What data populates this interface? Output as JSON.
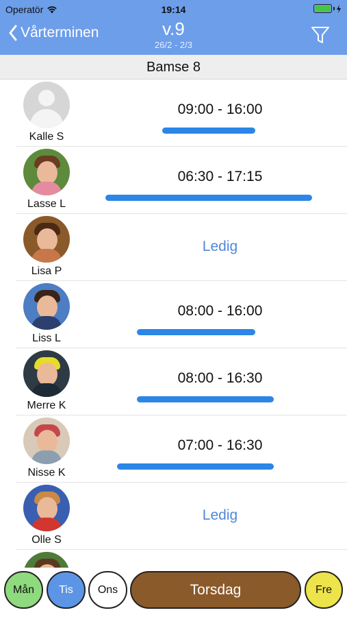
{
  "status": {
    "carrier": "Operatör",
    "time": "19:14"
  },
  "nav": {
    "back_label": "Vårterminen",
    "title": "v.9",
    "subtitle": "26/2 - 2/3"
  },
  "section": {
    "title": "Bamse 8"
  },
  "rows": [
    {
      "name": "Kalle S",
      "time": "09:00 - 16:00",
      "free": "",
      "bar_start": 0.25,
      "bar_end": 0.66
    },
    {
      "name": "Lasse L",
      "time": "06:30 - 17:15",
      "free": "",
      "bar_start": 0.0,
      "bar_end": 0.91
    },
    {
      "name": "Lisa P",
      "time": "",
      "free": "Ledig"
    },
    {
      "name": "Liss L",
      "time": "08:00 - 16:00",
      "free": "",
      "bar_start": 0.14,
      "bar_end": 0.66
    },
    {
      "name": "Merre K",
      "time": "08:00 - 16:30",
      "free": "",
      "bar_start": 0.14,
      "bar_end": 0.74
    },
    {
      "name": "Nisse K",
      "time": "07:00 - 16:30",
      "free": "",
      "bar_start": 0.05,
      "bar_end": 0.74
    },
    {
      "name": "Olle S",
      "time": "",
      "free": "Ledig"
    }
  ],
  "days": [
    {
      "label": "Mån",
      "color": "#8fd97e"
    },
    {
      "label": "Tis",
      "color": "#5c95e6"
    },
    {
      "label": "Ons",
      "color": "#ffffff"
    },
    {
      "label": "Torsdag",
      "color": "#8b5a2b"
    },
    {
      "label": "Fre",
      "color": "#ede34a"
    }
  ],
  "colors": {
    "header": "#6c9eea",
    "bar": "#2b86e6",
    "free_text": "#4f86d9"
  },
  "icons": {
    "back": "chevron-left-icon",
    "filter": "filter-icon",
    "wifi": "wifi-icon",
    "battery": "battery-icon"
  }
}
